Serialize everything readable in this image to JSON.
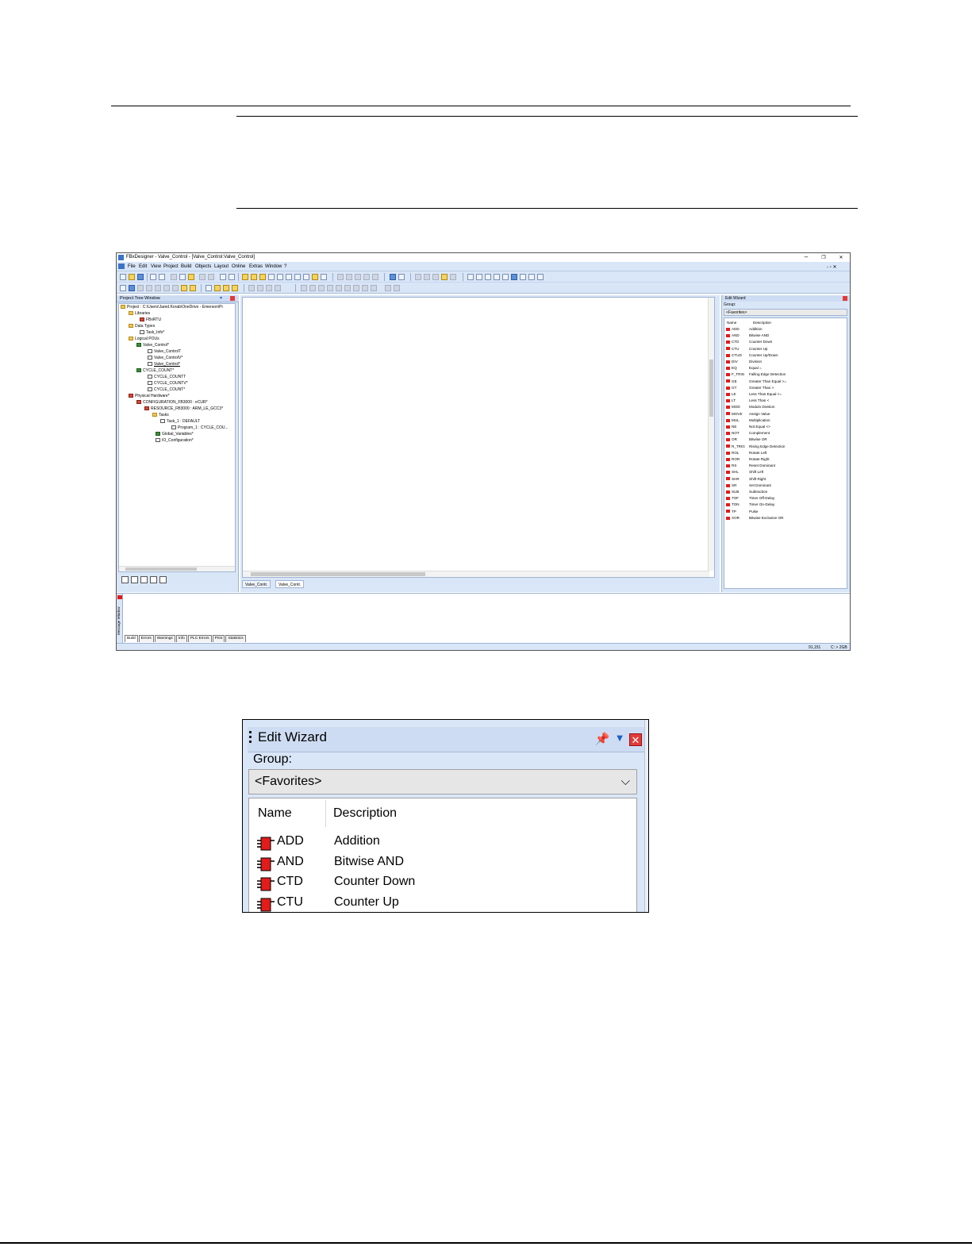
{
  "window": {
    "title": "FBxDesigner - Valve_Control - [Valve_Control:Valve_Control]",
    "min": "–",
    "max": "❐",
    "close": "✕",
    "mdi": "- ▫ ✕"
  },
  "menu": [
    "File",
    "Edit",
    "View",
    "Project",
    "Build",
    "Objects",
    "Layout",
    "Online",
    "Extras",
    "Window",
    "?"
  ],
  "project_tree": {
    "title": "Project Tree Window",
    "nodes": [
      {
        "label": "Project : C:\\Users\\Jared.Korab\\OneDrive - Emerson\\Pr",
        "icon": "folder-icon"
      },
      {
        "label": "Libraries",
        "icon": "folder-icon"
      },
      {
        "label": "FBxRTU",
        "icon": "library-icon"
      },
      {
        "label": "Data Types",
        "icon": "folder-icon"
      },
      {
        "label": "Task_Info*",
        "icon": "document-icon"
      },
      {
        "label": "Logical POUs",
        "icon": "folder-icon"
      },
      {
        "label": "Valve_Control*",
        "icon": "pou-icon"
      },
      {
        "label": "Valve_ControlT",
        "icon": "document-icon"
      },
      {
        "label": "Valve_ControlV*",
        "icon": "document-icon"
      },
      {
        "label": "Valve_Control*",
        "icon": "document-icon"
      },
      {
        "label": "CYCLE_COUNT*",
        "icon": "pou-icon"
      },
      {
        "label": "CYCLE_COUNTT",
        "icon": "document-icon"
      },
      {
        "label": "CYCLE_COUNTV*",
        "icon": "document-icon"
      },
      {
        "label": "CYCLE_COUNT*",
        "icon": "document-icon"
      },
      {
        "label": "Physical Hardware*",
        "icon": "hardware-icon"
      },
      {
        "label": "CONFIGURATION_FB3000 : eCUR*",
        "icon": "hardware-icon"
      },
      {
        "label": "RESOURCE_FB3000 : ARM_LE_GCC3*",
        "icon": "hardware-icon"
      },
      {
        "label": "Tasks",
        "icon": "folder-icon"
      },
      {
        "label": "Task_1 : DEFAULT",
        "icon": "document-icon"
      },
      {
        "label": "Program_1 : CYCLE_COU...",
        "icon": "document-icon"
      },
      {
        "label": "Global_Variables*",
        "icon": "globe-icon"
      },
      {
        "label": "IO_Configuration*",
        "icon": "document-icon"
      }
    ]
  },
  "editor_tabs": [
    "Valve_Contr.",
    "Valve_Contr."
  ],
  "edit_wizard": {
    "title": "Edit Wizard",
    "group_label": "Group:",
    "group_value": "<Favorites>",
    "col_name": "Name",
    "col_desc": "Description",
    "items": [
      {
        "name": "ADD",
        "desc": "Addition"
      },
      {
        "name": "AND",
        "desc": "Bitwise AND"
      },
      {
        "name": "CTD",
        "desc": "Counter Down"
      },
      {
        "name": "CTU",
        "desc": "Counter Up"
      },
      {
        "name": "CTUD",
        "desc": "Counter Up/Down"
      },
      {
        "name": "DIV",
        "desc": "Division"
      },
      {
        "name": "EQ",
        "desc": "Equal ="
      },
      {
        "name": "F_TRIG",
        "desc": "Falling Edge Detection"
      },
      {
        "name": "GE",
        "desc": "Greater Than Equal >="
      },
      {
        "name": "GT",
        "desc": "Greater Than >"
      },
      {
        "name": "LE",
        "desc": "Less Than Equal <="
      },
      {
        "name": "LT",
        "desc": "Less Than <"
      },
      {
        "name": "MOD",
        "desc": "Modulo Division"
      },
      {
        "name": "MOVE",
        "desc": "Assign Value"
      },
      {
        "name": "MUL",
        "desc": "Multiplication"
      },
      {
        "name": "NE",
        "desc": "Not Equal <>"
      },
      {
        "name": "NOT",
        "desc": "Complement"
      },
      {
        "name": "OR",
        "desc": "Bitwise OR"
      },
      {
        "name": "R_TRIG",
        "desc": "Rising Edge Detection"
      },
      {
        "name": "ROL",
        "desc": "Rotate Left"
      },
      {
        "name": "ROR",
        "desc": "Rotate Right"
      },
      {
        "name": "RS",
        "desc": "Reset Dominant"
      },
      {
        "name": "SHL",
        "desc": "Shift Left"
      },
      {
        "name": "SHR",
        "desc": "Shift Right"
      },
      {
        "name": "SR",
        "desc": "Set Dominant"
      },
      {
        "name": "SUB",
        "desc": "Subtraction"
      },
      {
        "name": "TOF",
        "desc": "Timer Off-Delay"
      },
      {
        "name": "TON",
        "desc": "Timer On-Delay"
      },
      {
        "name": "TP",
        "desc": "Pulse"
      },
      {
        "name": "XOR",
        "desc": "Bitwise Exclusive OR"
      }
    ]
  },
  "message_window": {
    "label": "Message Window",
    "tabs": [
      "Build",
      "Errors",
      "Warnings",
      "Info",
      "PLC Errors",
      "Print",
      "Statistics"
    ]
  },
  "status": {
    "position": "91,151",
    "drive": "C: > 2GB"
  },
  "zoom": {
    "title": "Edit Wizard",
    "group_label": "Group:",
    "group_value": "<Favorites>",
    "col_name": "Name",
    "col_desc": "Description",
    "items": [
      {
        "name": "ADD",
        "desc": "Addition"
      },
      {
        "name": "AND",
        "desc": "Bitwise AND"
      },
      {
        "name": "CTD",
        "desc": "Counter Down"
      },
      {
        "name": "CTU",
        "desc": "Counter Up"
      }
    ]
  }
}
